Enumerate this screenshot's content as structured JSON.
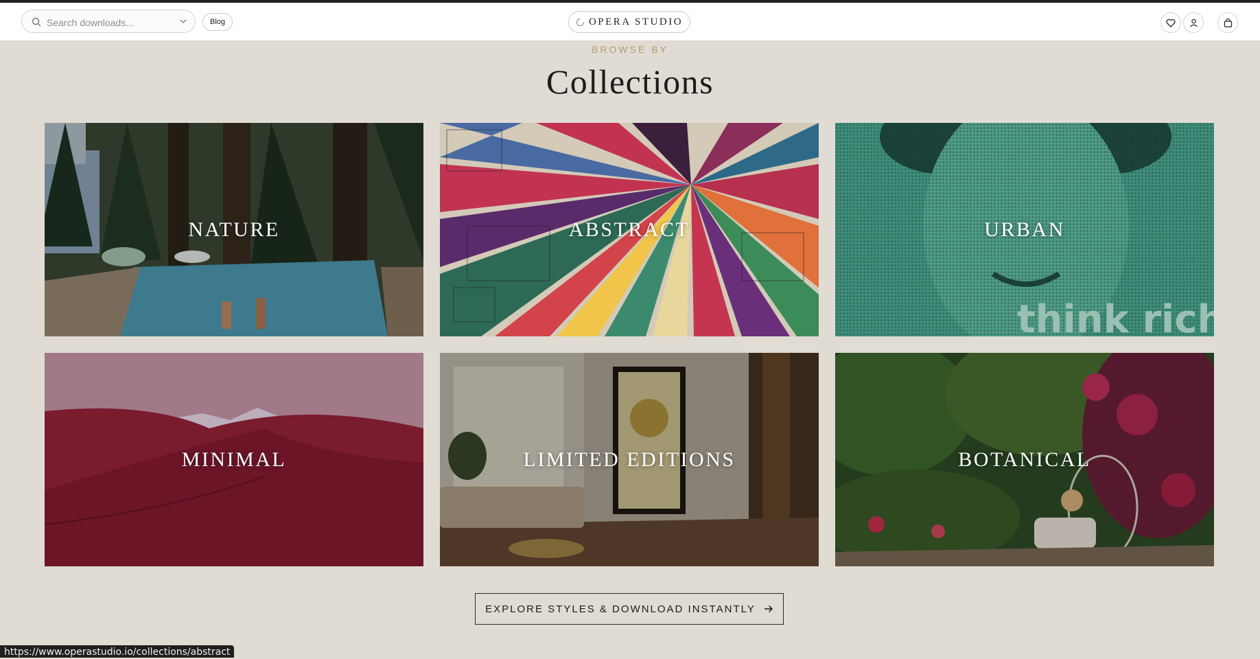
{
  "header": {
    "search_placeholder": "Search downloads...",
    "blog_label": "Blog",
    "logo_text": "OPERA STUDIO",
    "icons": [
      "heart-icon",
      "user-icon",
      "cart-icon"
    ]
  },
  "section": {
    "eyebrow": "BROWSE BY",
    "title": "Collections"
  },
  "collections": [
    {
      "label": "NATURE",
      "tint": "#2e6b88"
    },
    {
      "label": "ABSTRACT",
      "tint": "#c23352"
    },
    {
      "label": "URBAN",
      "tint": "#3f8c79"
    },
    {
      "label": "MINIMAL",
      "tint": "#7e1c2c"
    },
    {
      "label": "LIMITED EDITIONS",
      "tint": "#8a7c68"
    },
    {
      "label": "BOTANICAL",
      "tint": "#365a30"
    }
  ],
  "urban_overlay_text": "think rich.",
  "cta_label": "EXPLORE STYLES & DOWNLOAD INSTANTLY",
  "status_url": "https://www.operastudio.io/collections/abstract",
  "colors": {
    "background": "#e0dcd4",
    "eyebrow": "#b39a70",
    "text": "#1c1c1c"
  }
}
